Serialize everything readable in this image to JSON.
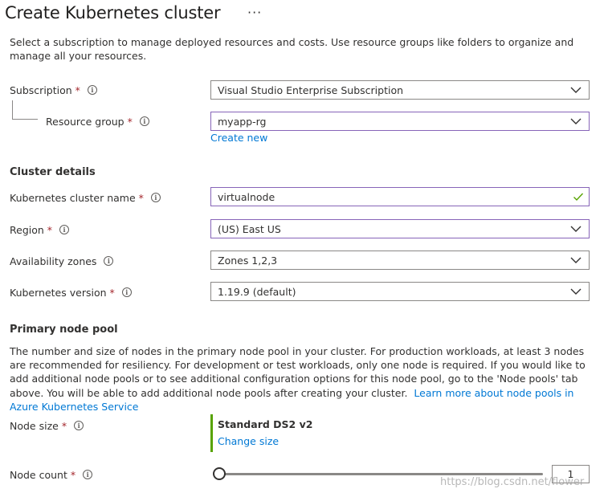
{
  "header": {
    "title": "Create Kubernetes cluster",
    "more": "···"
  },
  "intro_text": "Select a subscription to manage deployed resources and costs. Use resource groups like folders to organize and manage all your resources.",
  "required_mark": "*",
  "info_glyph": "i",
  "subscription": {
    "label": "Subscription",
    "value": "Visual Studio Enterprise Subscription"
  },
  "resource_group": {
    "label": "Resource group",
    "value": "myapp-rg",
    "create_new": "Create new"
  },
  "cluster_details": {
    "heading": "Cluster details",
    "name_label": "Kubernetes cluster name",
    "name_value": "virtualnode",
    "region_label": "Region",
    "region_value": "(US) East US",
    "zones_label": "Availability zones",
    "zones_value": "Zones 1,2,3",
    "version_label": "Kubernetes version",
    "version_value": "1.19.9 (default)"
  },
  "node_pool": {
    "heading": "Primary node pool",
    "description": "The number and size of nodes in the primary node pool in your cluster. For production workloads, at least 3 nodes are recommended for resiliency. For development or test workloads, only one node is required. If you would like to add additional node pools or to see additional configuration options for this node pool, go to the 'Node pools' tab above. You will be able to add additional node pools after creating your cluster.",
    "learn_more": "Learn more about node pools in Azure Kubernetes Service",
    "size_label": "Node size",
    "size_value": "Standard DS2 v2",
    "change_size": "Change size",
    "count_label": "Node count",
    "count_value": "1",
    "count_fraction": 0
  },
  "watermark": "https://blog.csdn.net/flower",
  "colors": {
    "link": "#0078d4",
    "required": "#a4262c",
    "focus_border": "#8764b8",
    "valid": "#57a300"
  },
  "icons": {
    "dropdown": "chevron-down-icon",
    "info": "info-icon",
    "valid": "checkmark-icon"
  }
}
